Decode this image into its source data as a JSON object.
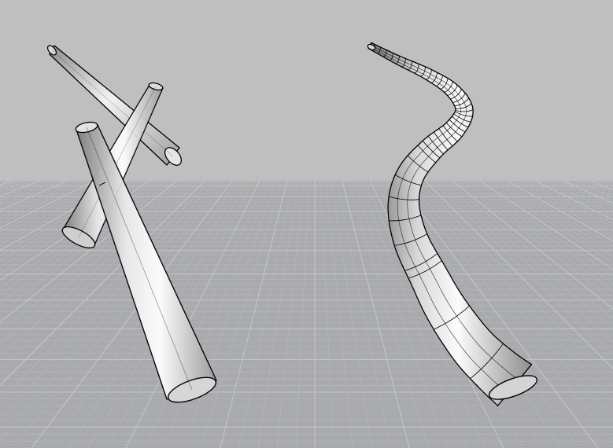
{
  "viewport": {
    "background_color": "#bfbfbf",
    "ground_color": "#a9aaad",
    "grid_minor_color": "#b6b7ba",
    "grid_major_color": "#c6c7ca",
    "object_fill_light": "#f4f4f4",
    "object_fill_dark": "#8a8a8a",
    "edge_color": "#000000"
  },
  "objects": [
    {
      "name": "tapered-tube-left-a",
      "kind": "tapered-tube"
    },
    {
      "name": "tapered-tube-left-b",
      "kind": "tapered-tube"
    },
    {
      "name": "tapered-tube-left-c",
      "kind": "tapered-tube"
    },
    {
      "name": "swept-curved-tube",
      "kind": "swept-tube-with-isocurves"
    }
  ]
}
